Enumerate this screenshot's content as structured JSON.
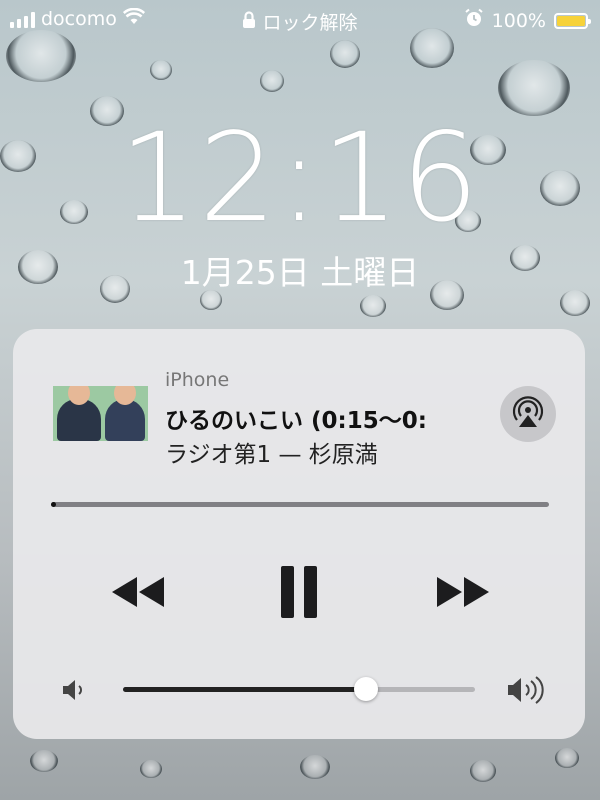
{
  "status_bar": {
    "carrier": "docomo",
    "lock_text": "ロック解除",
    "battery": "100%",
    "battery_level": 1.0,
    "battery_color": "#f6d23a"
  },
  "lock_screen": {
    "time": "12:16",
    "date": "1月25日 土曜日"
  },
  "now_playing": {
    "source": "iPhone",
    "track": "ひるのいこい (0:15〜0:",
    "artist": "ラジオ第1 — 杉原満",
    "progress": 0.01,
    "volume": 0.69,
    "icons": [
      "airplay-icon",
      "rewind-icon",
      "pause-icon",
      "fast-forward-icon",
      "volume-low-icon",
      "volume-high-icon"
    ]
  }
}
